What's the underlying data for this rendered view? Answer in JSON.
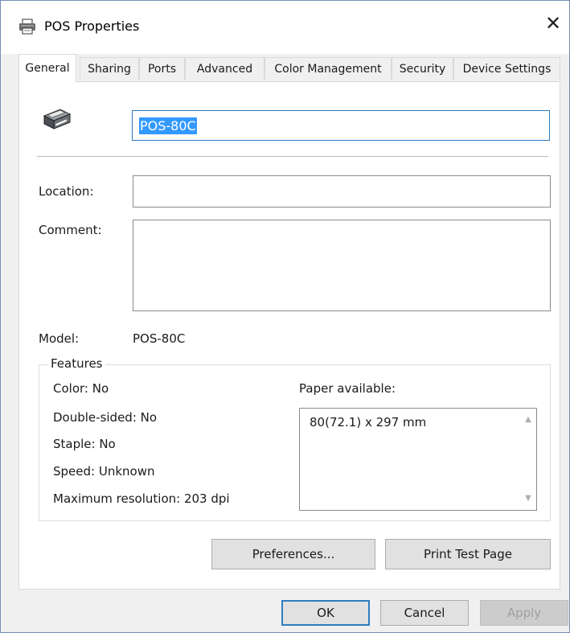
{
  "window": {
    "title": "POS Properties",
    "close_glyph": "✕"
  },
  "tabs": [
    {
      "label": "General",
      "active": true
    },
    {
      "label": "Sharing",
      "active": false
    },
    {
      "label": "Ports",
      "active": false
    },
    {
      "label": "Advanced",
      "active": false
    },
    {
      "label": "Color Management",
      "active": false
    },
    {
      "label": "Security",
      "active": false
    },
    {
      "label": "Device Settings",
      "active": false
    }
  ],
  "general": {
    "printer_name": "POS-80C",
    "location_label": "Location:",
    "location_value": "",
    "comment_label": "Comment:",
    "comment_value": "",
    "model_label": "Model:",
    "model_value": "POS-80C",
    "features_title": "Features",
    "features": {
      "color": "Color: No",
      "double_sided": "Double-sided: No",
      "staple": "Staple: No",
      "speed": "Speed: Unknown",
      "max_resolution": "Maximum resolution: 203 dpi"
    },
    "paper_label": "Paper available:",
    "paper_items": [
      "80(72.1) x 297 mm"
    ],
    "preferences_button": "Preferences...",
    "print_test_button": "Print Test Page"
  },
  "footer": {
    "ok": "OK",
    "cancel": "Cancel",
    "apply": "Apply"
  },
  "icons": {
    "title": "printer-icon",
    "printer": "printer-icon",
    "close": "close-icon"
  },
  "colors": {
    "accent": "#2f7cc0",
    "selection": "#3399ff",
    "window_border": "#6f8fb3"
  }
}
